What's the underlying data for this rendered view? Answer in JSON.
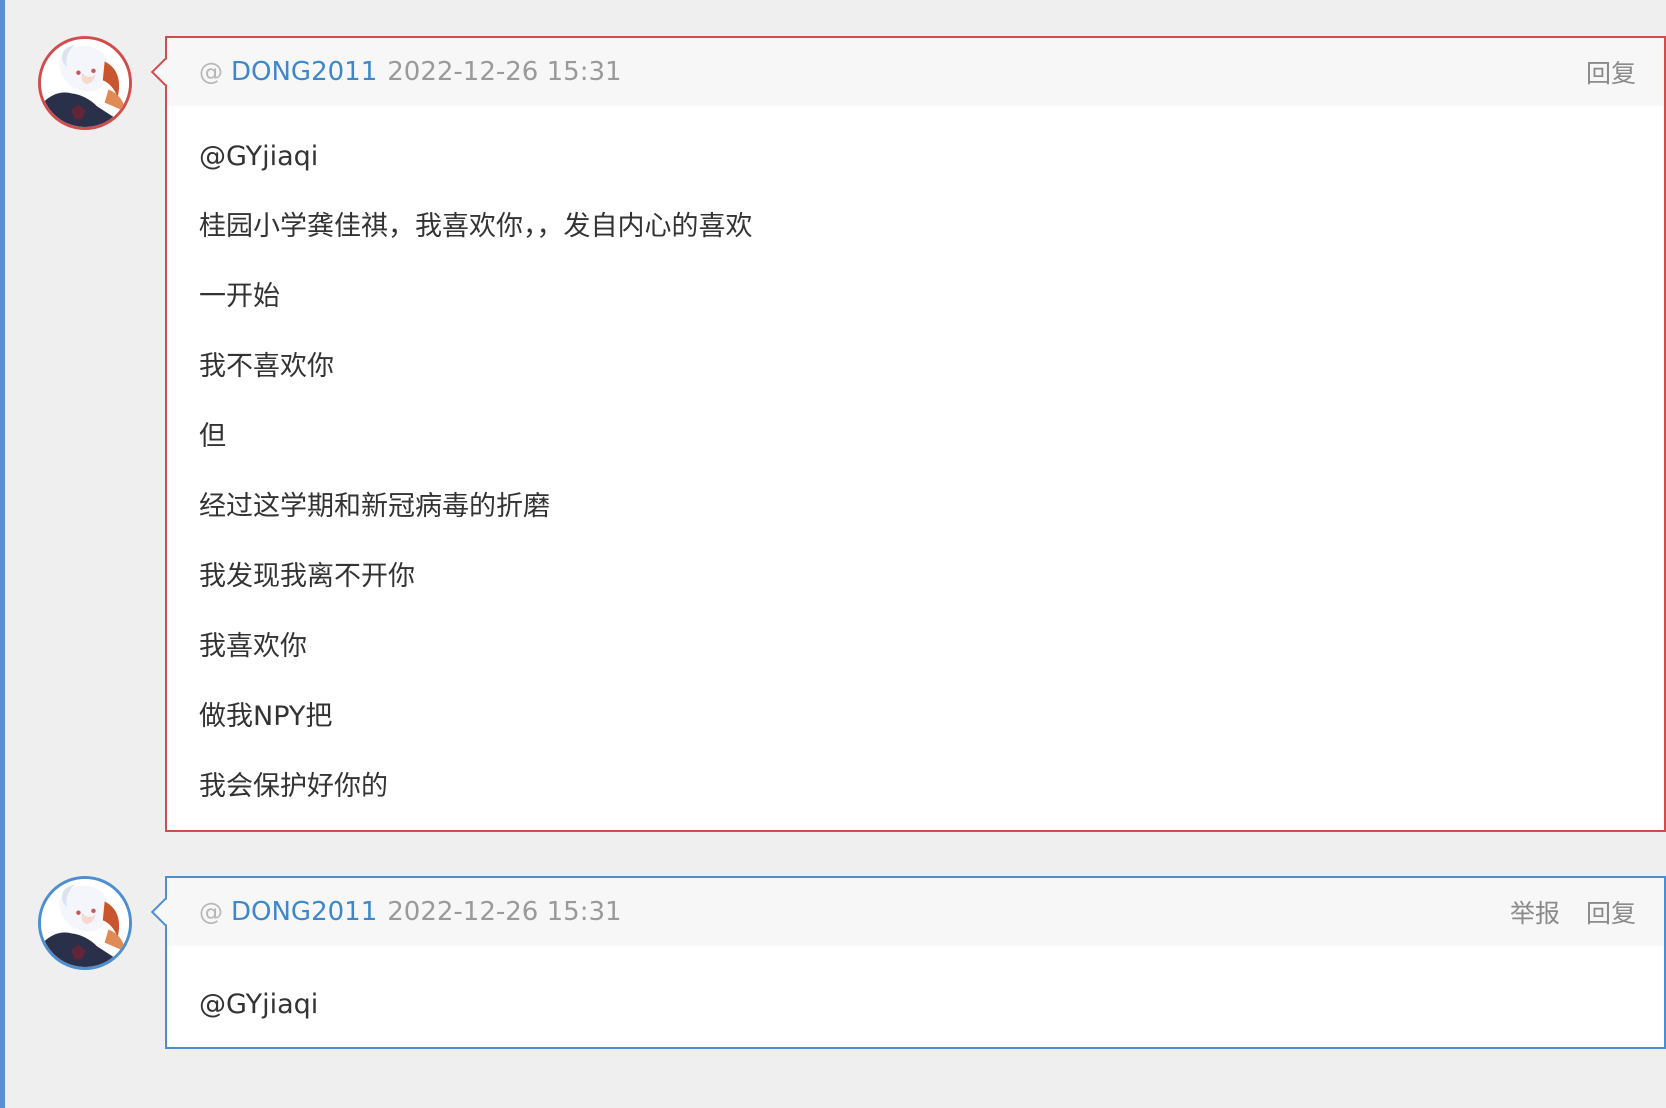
{
  "comments": [
    {
      "username": "DONG2011",
      "time": "2022-12-26 15:31",
      "actions": [
        "回复"
      ],
      "lines": [
        "@GYjiaqi",
        "桂园小学龚佳祺，我喜欢你，，发自内心的喜欢",
        "一开始",
        "我不喜欢你",
        "但",
        "经过这学期和新冠病毒的折磨",
        "我发现我离不开你",
        "我喜欢你",
        "做我NPY把",
        "我会保护好你的"
      ],
      "colors": {
        "border": "#d24c4c"
      }
    },
    {
      "username": "DONG2011",
      "time": "2022-12-26 15:31",
      "actions": [
        "举报",
        "回复"
      ],
      "lines": [
        "@GYjiaqi"
      ],
      "colors": {
        "border": "#4d8ed1"
      }
    }
  ],
  "ui": {
    "at_symbol": "@"
  }
}
